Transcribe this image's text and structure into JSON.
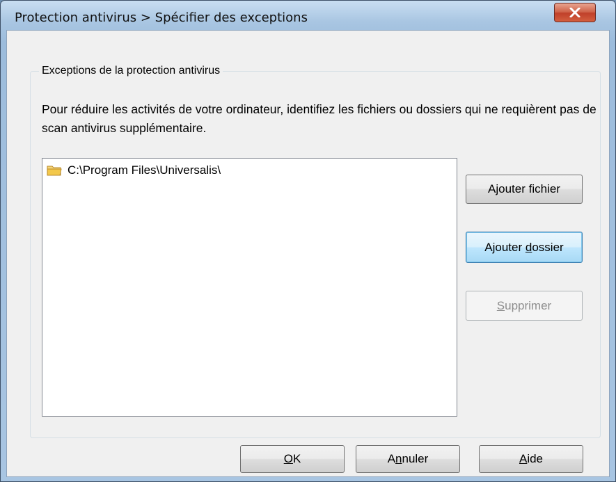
{
  "window": {
    "title": "Protection antivirus > Spécifier des exceptions"
  },
  "group": {
    "title": "Exceptions de la protection antivirus",
    "description": "Pour réduire les activités de votre ordinateur, identifiez les fichiers ou dossiers qui ne requièrent pas de scan antivirus supplémentaire."
  },
  "exceptions_list": {
    "items": [
      {
        "path": "C:\\Program Files\\Universalis\\",
        "icon": "folder-icon"
      }
    ]
  },
  "buttons": {
    "add_file": {
      "label": "Ajouter fichier",
      "accel": "",
      "state": "enabled"
    },
    "add_folder": {
      "pre": "Ajouter ",
      "accel": "d",
      "post": "ossier",
      "state": "focused"
    },
    "remove": {
      "pre": "",
      "accel": "S",
      "post": "upprimer",
      "state": "disabled"
    },
    "ok": {
      "pre": "",
      "accel": "O",
      "post": "K"
    },
    "cancel": {
      "pre": "A",
      "accel": "n",
      "post": "nuler"
    },
    "help": {
      "pre": "",
      "accel": "A",
      "post": "ide"
    }
  },
  "colors": {
    "dialog_background": "#f0f0f0",
    "close_button": "#c8452d",
    "focus_border": "#3c7fb1",
    "folder_icon": "#f3c84b"
  }
}
